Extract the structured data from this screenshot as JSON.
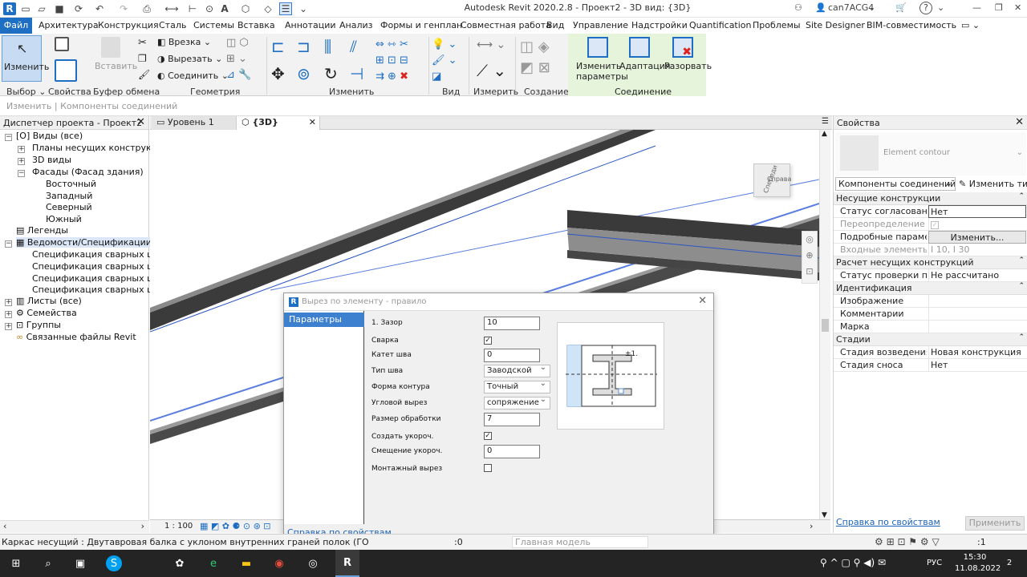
{
  "titlebar": {
    "title": "Autodesk Revit 2020.2.8 - Проект2 - 3D вид: {3D}",
    "user": "can7ACG4",
    "help": "?"
  },
  "menu": {
    "tabs": [
      "Файл",
      "Архитектура",
      "Конструкция",
      "Сталь",
      "Системы",
      "Вставка",
      "Аннотации",
      "Анализ",
      "Формы и генплан",
      "Совместная работа",
      "Вид",
      "Управление",
      "Надстройки",
      "Quantification",
      "Проблемы",
      "Site Designer",
      "BIM-совместимость"
    ]
  },
  "ribbon": {
    "modify": "Изменить",
    "paste": "Вставить",
    "cope": "Врезка",
    "cut": "Вырезать",
    "join": "Соединить",
    "edit_params_1": "Изменить",
    "edit_params_2": "параметры",
    "adapt": "Адаптация",
    "explode": "Разорвать",
    "groups": {
      "select": "Выбор",
      "props": "Свойства",
      "clipboard": "Буфер обмена",
      "geometry": "Геометрия",
      "modify": "Изменить",
      "view": "Вид",
      "measure": "Измерить",
      "create": "Создание",
      "connection": "Соединение"
    },
    "subbar": "Изменить | Компоненты соединений"
  },
  "project_browser": {
    "title": "Диспетчер проекта - Проект2",
    "items": [
      {
        "label": "Виды (все)"
      },
      {
        "label": "Планы несущих конструкций"
      },
      {
        "label": "3D виды"
      },
      {
        "label": "Фасады (Фасад здания)"
      },
      {
        "label": "Восточный"
      },
      {
        "label": "Западный"
      },
      {
        "label": "Северный"
      },
      {
        "label": "Южный"
      },
      {
        "label": "Легенды"
      },
      {
        "label": "Ведомости/Спецификации (все"
      },
      {
        "label": "Спецификация сварных швов"
      },
      {
        "label": "Спецификация сварных швов :"
      },
      {
        "label": "Спецификация сварных швов :"
      },
      {
        "label": "Спецификация сварных швов -"
      },
      {
        "label": "Листы (все)"
      },
      {
        "label": "Семейства"
      },
      {
        "label": "Группы"
      },
      {
        "label": "Связанные файлы Revit"
      }
    ]
  },
  "view_tabs": {
    "level1": "Уровень 1",
    "view3d": "{3D}",
    "scale": "1 : 100"
  },
  "viewcube": {
    "front": "Спереди",
    "right": "Справа"
  },
  "properties": {
    "title": "Свойства",
    "type_name": "Element contour",
    "selector": "Компоненты соединений (1)",
    "edit_type": "Изменить тип",
    "cat1": "Несущие конструкции",
    "r1k": "Статус согласования",
    "r1v": "Нет",
    "r2k": "Переопределение по...",
    "r3k": "Подробные парамет...",
    "r3v": "Изменить...",
    "r4k": "Входные элементы",
    "r4v": "I 10, I 30",
    "cat2": "Расчет несущих конструкций",
    "r5k": "Статус проверки по н...",
    "r5v": "Не рассчитано",
    "cat3": "Идентификация",
    "r6k": "Изображение",
    "r7k": "Комментарии",
    "r8k": "Марка",
    "cat4": "Стадии",
    "r9k": "Стадия возведения",
    "r9v": "Новая конструкция",
    "r10k": "Стадия сноса",
    "r10v": "Нет",
    "help": "Справка по свойствам",
    "apply": "Применить"
  },
  "dialog": {
    "title": "Вырез по элементу - правило",
    "nav": "Параметры",
    "gap_label": "1. Зазор",
    "gap_value": "10",
    "weld_label": "Сварка",
    "leg_label": "Катет шва",
    "leg_value": "0",
    "weldtype_label": "Тип шва",
    "weldtype_value": "Заводской",
    "contour_label": "Форма контура",
    "contour_value": "Точный",
    "corner_label": "Угловой вырез",
    "corner_value": "сопряжение",
    "proc_label": "Размер обработки",
    "proc_value": "7",
    "short_label": "Создать укороч.",
    "offset_label": "Смещение укороч.",
    "offset_value": "0",
    "mount_label": "Монтажный вырез",
    "preview_mark": "±1.",
    "help": "Справка по свойствам"
  },
  "status": {
    "text": "Каркас несущий : Двутавровая балка с уклоном внутренних граней полок (ГО",
    "zero": ":0",
    "model": "Главная модель",
    "filter": ":1"
  },
  "taskbar": {
    "lang": "РУС",
    "time": "15:30",
    "date": "11.08.2022",
    "notif": "2"
  }
}
